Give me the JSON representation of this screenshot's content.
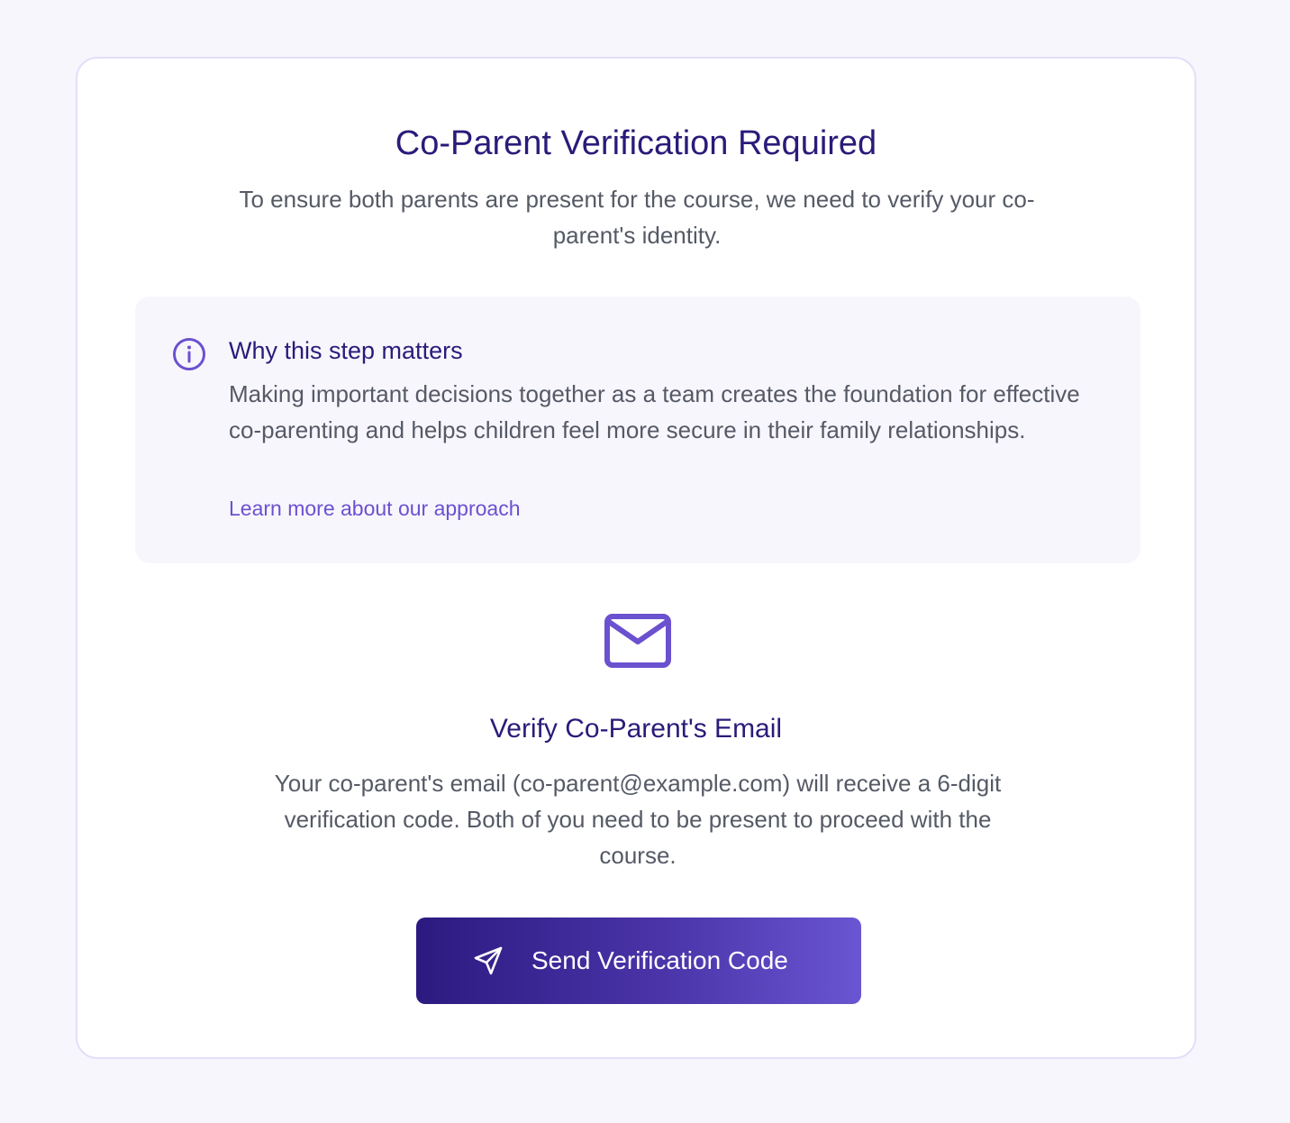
{
  "header": {
    "title": "Co-Parent Verification Required",
    "subtitle": "To ensure both parents are present for the course, we need to verify your co-parent's identity."
  },
  "info": {
    "icon": "info-circle-icon",
    "heading": "Why this step matters",
    "text": "Making important decisions together as a team creates the foundation for effective co-parenting and helps children feel more secure in their family relationships.",
    "link_label": "Learn more about our approach"
  },
  "verify": {
    "icon": "mail-icon",
    "heading": "Verify Co-Parent's Email",
    "text": "Your co-parent's email (co-parent@example.com) will receive a 6-digit verification code. Both of you need to be present to proceed with the course."
  },
  "action": {
    "icon": "send-icon",
    "button_label": "Send Verification Code"
  },
  "colors": {
    "background": "#f8f6fd",
    "card": "#ffffff",
    "heading": "#2a1b7a",
    "body_text": "#555a66",
    "accent": "#6b51cf",
    "button_gradient_start": "#2c1a80",
    "button_gradient_end": "#6a55d2"
  }
}
